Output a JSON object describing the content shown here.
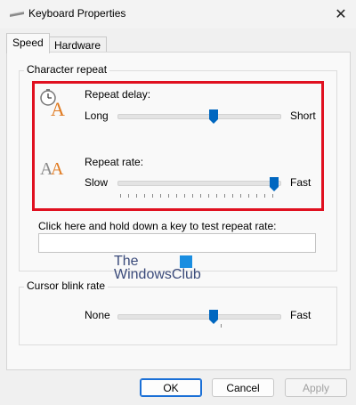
{
  "window": {
    "title": "Keyboard Properties",
    "close_glyph": "✕"
  },
  "tabs": [
    {
      "label": "Speed",
      "active": true
    },
    {
      "label": "Hardware",
      "active": false
    }
  ],
  "character_repeat": {
    "group_label": "Character repeat",
    "repeat_delay": {
      "label": "Repeat delay:",
      "min_label": "Long",
      "max_label": "Short",
      "level": 0.6
    },
    "repeat_rate": {
      "label": "Repeat rate:",
      "min_label": "Slow",
      "max_label": "Fast",
      "level": 1.0
    },
    "test_prompt": "Click here and hold down a key to test repeat rate:",
    "test_value": ""
  },
  "cursor_blink": {
    "group_label": "Cursor blink rate",
    "min_label": "None",
    "max_label": "Fast",
    "level": 0.6
  },
  "watermark": {
    "line1": "The",
    "line2": "WindowsClub"
  },
  "buttons": {
    "ok": "OK",
    "cancel": "Cancel",
    "apply": "Apply"
  },
  "colors": {
    "accent": "#0067c0",
    "highlight": "#e01020"
  }
}
